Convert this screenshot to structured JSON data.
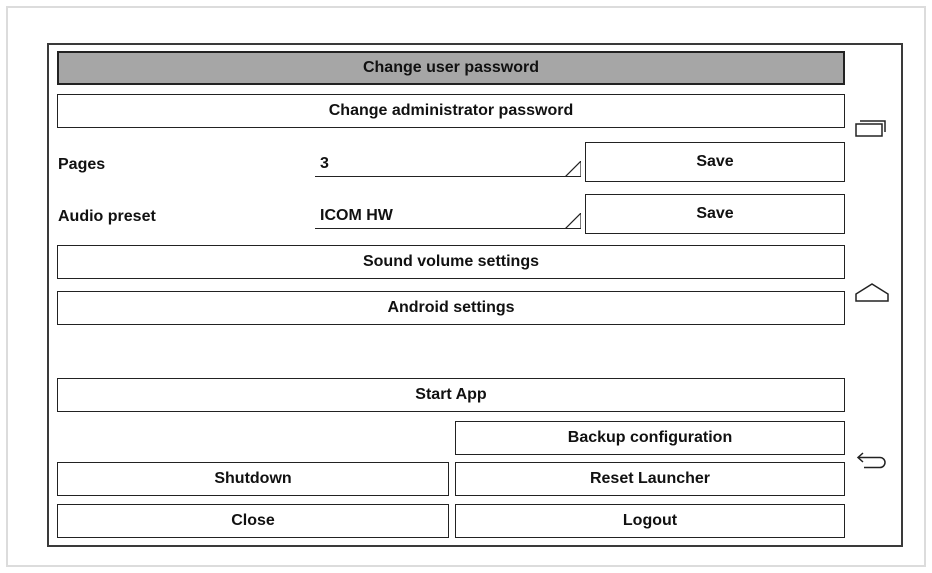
{
  "menu": {
    "change_user_password": "Change user password",
    "change_admin_password": "Change administrator password",
    "sound_volume_settings": "Sound volume settings",
    "android_settings": "Android settings",
    "start_app": "Start App",
    "backup_configuration": "Backup configuration",
    "shutdown": "Shutdown",
    "reset_launcher": "Reset Launcher",
    "close": "Close",
    "logout": "Logout"
  },
  "pages": {
    "label": "Pages",
    "value": "3",
    "save_label": "Save"
  },
  "audio": {
    "label": "Audio preset",
    "value": "ICOM HW",
    "save_label": "Save"
  },
  "nav": {
    "icons": [
      "recent-apps-icon",
      "home-icon",
      "back-icon"
    ]
  },
  "colors": {
    "active_button": "#a6a6a6",
    "border": "#222222"
  }
}
